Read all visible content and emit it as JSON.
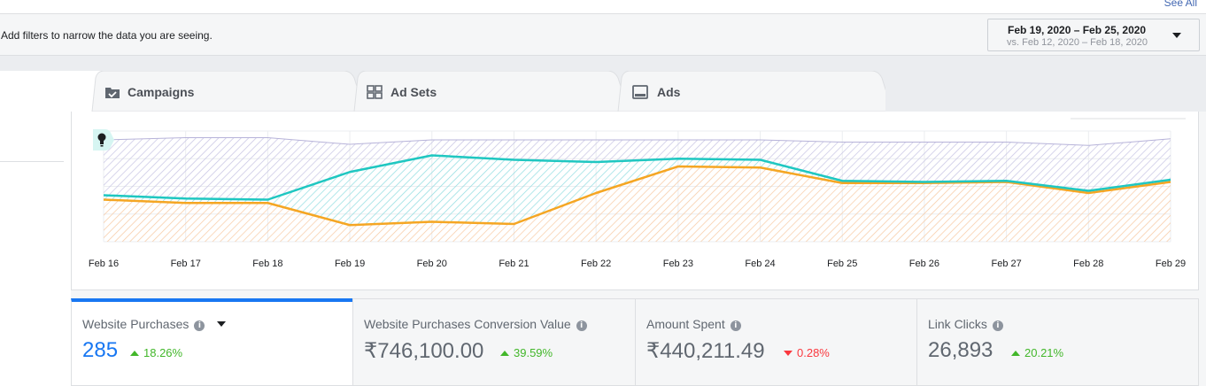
{
  "header": {
    "see_all": "See All",
    "filter_hint": "Add filters to narrow the data you are seeing.",
    "date_range": "Feb 19, 2020 – Feb 25, 2020",
    "compare_range": "vs. Feb 12, 2020 – Feb 18, 2020"
  },
  "tabs": [
    {
      "label": "Campaigns",
      "icon": "folder-check-icon"
    },
    {
      "label": "Ad Sets",
      "icon": "grid-icon"
    },
    {
      "label": "Ads",
      "icon": "monitor-icon"
    }
  ],
  "chart_data": {
    "type": "line",
    "categories": [
      "Feb 16",
      "Feb 17",
      "Feb 18",
      "Feb 19",
      "Feb 20",
      "Feb 21",
      "Feb 22",
      "Feb 23",
      "Feb 24",
      "Feb 25",
      "Feb 26",
      "Feb 27",
      "Feb 28",
      "Feb 29"
    ],
    "series": [
      {
        "color": "#1fc7c1",
        "values": [
          0.42,
          0.39,
          0.38,
          0.63,
          0.78,
          0.74,
          0.72,
          0.75,
          0.74,
          0.55,
          0.54,
          0.55,
          0.46,
          0.56
        ]
      },
      {
        "color": "#f5a623",
        "values": [
          0.38,
          0.35,
          0.35,
          0.15,
          0.18,
          0.16,
          0.44,
          0.68,
          0.67,
          0.53,
          0.53,
          0.54,
          0.44,
          0.54
        ]
      }
    ],
    "background_band": {
      "color": "#b7b3d9",
      "values": [
        0.92,
        0.94,
        0.94,
        0.88,
        0.92,
        0.92,
        0.92,
        0.92,
        0.92,
        0.9,
        0.9,
        0.9,
        0.87,
        0.93
      ]
    },
    "ylim": [
      0,
      1
    ],
    "grid": true,
    "title": "",
    "xlabel": "",
    "ylabel": ""
  },
  "metrics": [
    {
      "label": "Website Purchases",
      "value": "285",
      "change": "18.26%",
      "direction": "up",
      "active": true
    },
    {
      "label": "Website Purchases Conversion Value",
      "value": "₹746,100.00",
      "change": "39.59%",
      "direction": "up",
      "active": false
    },
    {
      "label": "Amount Spent",
      "value": "₹440,211.49",
      "change": "0.28%",
      "direction": "down",
      "active": false
    },
    {
      "label": "Link Clicks",
      "value": "26,893",
      "change": "20.21%",
      "direction": "up",
      "active": false
    }
  ],
  "colors": {
    "accent": "#1877f2",
    "positive": "#42b72a",
    "negative": "#fa383e"
  }
}
